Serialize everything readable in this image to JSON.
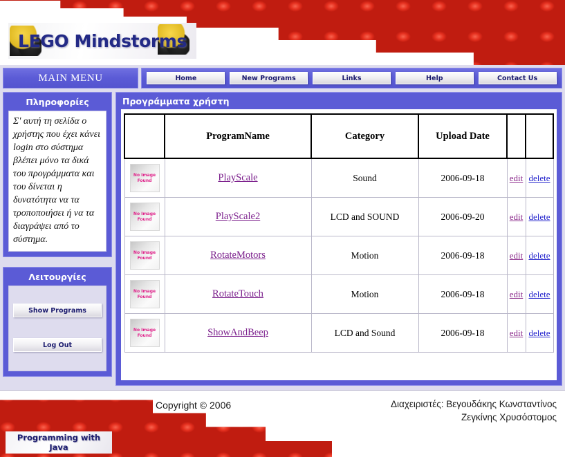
{
  "banner": {
    "logo_text": "LEGO Mindstorms"
  },
  "menu": {
    "main_menu_label": "MAIN MENU",
    "nav_items": [
      {
        "label": "Home"
      },
      {
        "label": "New Programs"
      },
      {
        "label": "Links"
      },
      {
        "label": "Help"
      },
      {
        "label": "Contact Us"
      }
    ]
  },
  "sidebar": {
    "info_panel": {
      "title": "Πληροφορίες",
      "text": "Σ' αυτή τη σελίδα ο χρήστης που έχει κάνει login στο σύστημα βλέπει μόνο τα δικά του προγράμματα και του δίνεται η δυνατότητα να τα τροποποιήσει ή να τα διαγράψει από το σύστημα."
    },
    "ops_panel": {
      "title": "Λειτουργίες",
      "buttons": [
        {
          "label": "Show Programs"
        },
        {
          "label": "Log Out"
        }
      ]
    }
  },
  "main": {
    "title": "Προγράμματα χρήστη",
    "table": {
      "headers": [
        "",
        "ProgramName",
        "Category",
        "Upload Date",
        "",
        ""
      ],
      "thumb_placeholder": "No Image Found",
      "thumb_line1": "No Image",
      "thumb_line2": "Found",
      "edit_label": "edit",
      "delete_label": "delete",
      "rows": [
        {
          "name": "PlayScale",
          "category": "Sound",
          "date": "2006-09-18"
        },
        {
          "name": "PlayScale2",
          "category": "LCD and SOUND",
          "date": "2006-09-20"
        },
        {
          "name": "RotateMotors",
          "category": "Motion",
          "date": "2006-09-18"
        },
        {
          "name": "RotateTouch",
          "category": "Motion",
          "date": "2006-09-18"
        },
        {
          "name": "ShowAndBeep",
          "category": "LCD and Sound",
          "date": "2006-09-18"
        }
      ]
    }
  },
  "footer": {
    "copyright": "Copyright © 2006",
    "admins_line1": "Διαχειριστές: Βεγουδάκης Κωνσταντίνος",
    "admins_line2": "Ζεγκίνης Χρυσόστομος",
    "badge_line1": "Programming with",
    "badge_line2": "Java"
  },
  "colors": {
    "purple": "#5b5bd6",
    "lavender_bg": "#dedcee",
    "brick_red": "#e02b1c",
    "link_purple": "#7b1f8c",
    "link_blue": "#2222cc",
    "noimage_pink": "#e0218a",
    "button_text": "#1b1b6e"
  }
}
